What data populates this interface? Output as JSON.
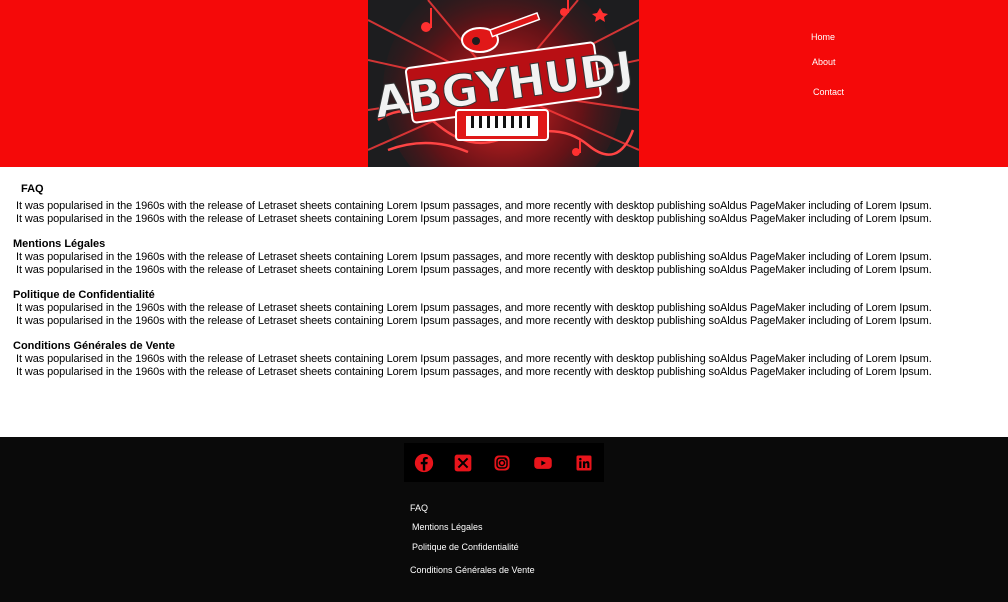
{
  "header": {
    "logo_text": "ABGYHUDJ",
    "nav": [
      "Home",
      "About",
      "Contact"
    ]
  },
  "sections": [
    {
      "title": "FAQ",
      "lines": [
        "It was popularised in the 1960s with the release of Letraset sheets  containing Lorem Ipsum passages, and more recently with desktop  publishing soAldus PageMaker including of Lorem  Ipsum.",
        "It was popularised in the 1960s with the release of Letraset sheets  containing Lorem Ipsum passages, and more recently with desktop  publishing soAldus PageMaker including of Lorem  Ipsum."
      ]
    },
    {
      "title": "Mentions Légales",
      "lines": [
        "It was popularised in the 1960s with the release of Letraset sheets  containing Lorem Ipsum passages, and more recently with desktop  publishing soAldus PageMaker including of Lorem  Ipsum.",
        "It was popularised in the 1960s with the release of Letraset sheets  containing Lorem Ipsum passages, and more recently with desktop  publishing soAldus PageMaker including of Lorem  Ipsum."
      ]
    },
    {
      "title": "Politique de Confidentialité",
      "lines": [
        "It was popularised in the 1960s with the release of Letraset sheets  containing Lorem Ipsum passages, and more recently with desktop  publishing soAldus PageMaker including of Lorem  Ipsum.",
        "It was popularised in the 1960s with the release of Letraset sheets  containing Lorem Ipsum passages, and more recently with desktop  publishing soAldus PageMaker including of Lorem  Ipsum."
      ]
    },
    {
      "title": "Conditions Générales de Vente",
      "lines": [
        "It was popularised in the 1960s with the release of Letraset sheets  containing Lorem Ipsum passages, and more recently with desktop  publishing soAldus PageMaker including of Lorem  Ipsum.",
        "It was popularised in the 1960s with the release of Letraset sheets  containing Lorem Ipsum passages, and more recently with desktop  publishing soAldus PageMaker including of Lorem  Ipsum."
      ]
    }
  ],
  "footer": {
    "social_icons": [
      "facebook-icon",
      "x-icon",
      "instagram-icon",
      "youtube-icon",
      "linkedin-icon"
    ],
    "links": [
      "FAQ",
      "Mentions Légales",
      "Politique de Confidentialité",
      "Conditions Générales de Vente"
    ]
  },
  "colors": {
    "header_red": "#f50909",
    "icon_red": "#e8141b",
    "footer_bg": "#0a0a0a"
  }
}
